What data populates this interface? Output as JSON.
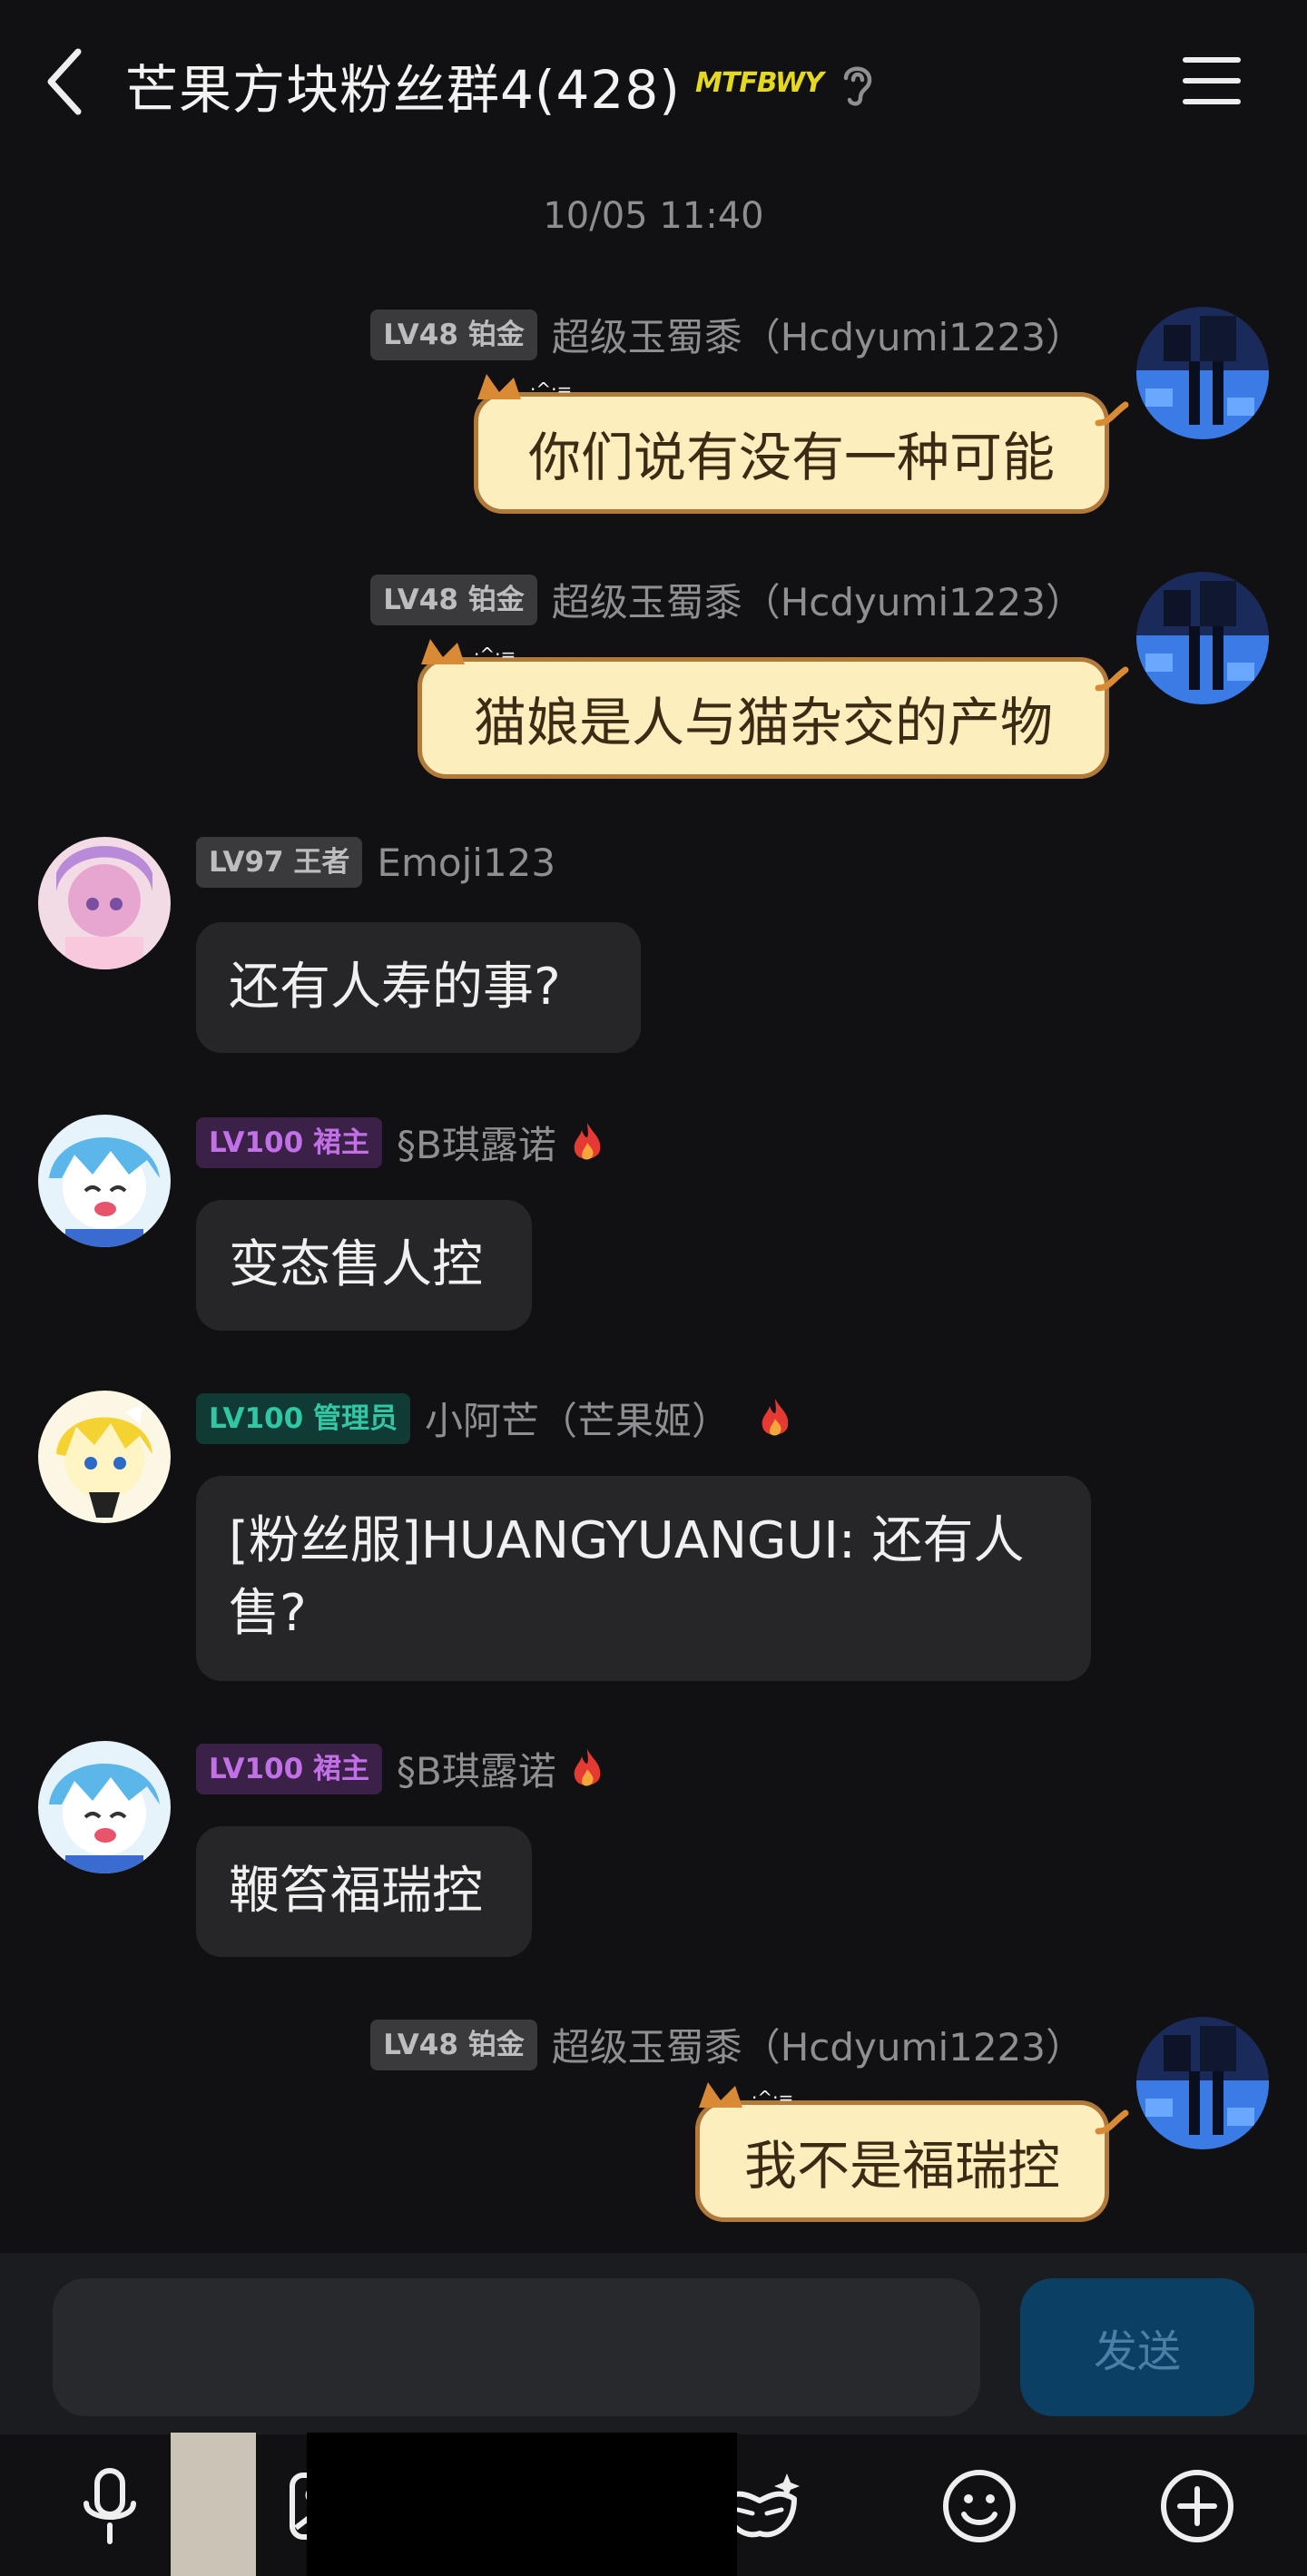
{
  "header": {
    "title": "芒果方块粉丝群4(428)",
    "badge": "MTFBWY"
  },
  "timestamp": "10/05 11:40",
  "messages": [
    {
      "level": "LV48 铂金",
      "name": "超级玉蜀黍（Hcdyumi1223）",
      "text": "你们说有没有一种可能"
    },
    {
      "level": "LV48 铂金",
      "name": "超级玉蜀黍（Hcdyumi1223）",
      "text": "猫娘是人与猫杂交的产物"
    },
    {
      "level": "LV97 王者",
      "name": "Emoji123",
      "text": "还有人寿的事?"
    },
    {
      "level": "LV100 裙主",
      "name": "§B琪露诺",
      "text": "变态售人控"
    },
    {
      "level": "LV100 管理员",
      "name": "小阿芒（芒果姬）",
      "text": "[粉丝服]HUANGYUANGUI: 还有人售?"
    },
    {
      "level": "LV100 裙主",
      "name": "§B琪露诺",
      "text": "鞭笞福瑞控"
    },
    {
      "level": "LV48 铂金",
      "name": "超级玉蜀黍（Hcdyumi1223）",
      "text": "我不是福瑞控"
    }
  ],
  "input": {
    "placeholder": "",
    "send_label": "发送"
  },
  "toolbar": [
    "mic-icon",
    "image-icon",
    "camera-icon",
    "mask-icon",
    "emoji-icon",
    "plus-icon"
  ],
  "colors": {
    "background": "#111113",
    "bubble_dark": "#262629",
    "bubble_cat": "#fcefbd",
    "send_button": "#0c3f64",
    "lv_purple": "#c170e6",
    "lv_teal": "#2fc7a4"
  }
}
